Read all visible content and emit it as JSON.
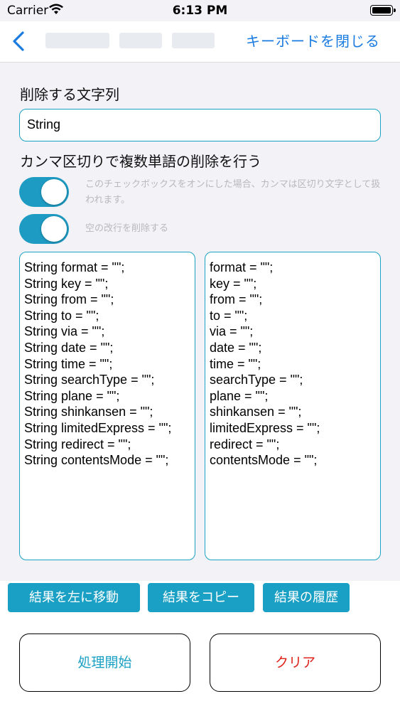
{
  "status_bar": {
    "carrier": "Carrier",
    "time": "6:13 PM"
  },
  "nav": {
    "close_keyboard": "キーボードを閉じる"
  },
  "delete_section": {
    "label": "削除する文字列",
    "value": "String"
  },
  "comma_section": {
    "label": "カンマ区切りで複数単語の削除を行う"
  },
  "toggles": [
    {
      "caption": "このチェックボックスをオンにした場合、カンマは区切り文字として扱われます。",
      "on": true
    },
    {
      "caption": "空の改行を削除する",
      "on": true
    }
  ],
  "input_text": "String format = \"\";\nString key = \"\";\nString from = \"\";\nString to = \"\";\nString via = \"\";\nString date = \"\";\nString time = \"\";\nString searchType = \"\";\nString plane = \"\";\nString shinkansen = \"\";\nString limitedExpress = \"\";\nString redirect = \"\";\nString contentsMode = \"\";",
  "output_text": "format = \"\";\nkey = \"\";\nfrom = \"\";\nto = \"\";\nvia = \"\";\ndate = \"\";\ntime = \"\";\nsearchType = \"\";\nplane = \"\";\nshinkansen = \"\";\nlimitedExpress = \"\";\nredirect = \"\";\ncontentsMode = \"\";",
  "actions": {
    "move_left": "結果を左に移動",
    "copy": "結果をコピー",
    "history": "結果の履歴",
    "start": "処理開始",
    "clear": "クリア"
  },
  "colors": {
    "accent": "#1aa0c4",
    "link": "#1a7be0",
    "clear_text": "#e0231c",
    "start_text": "#1aa0c4"
  }
}
